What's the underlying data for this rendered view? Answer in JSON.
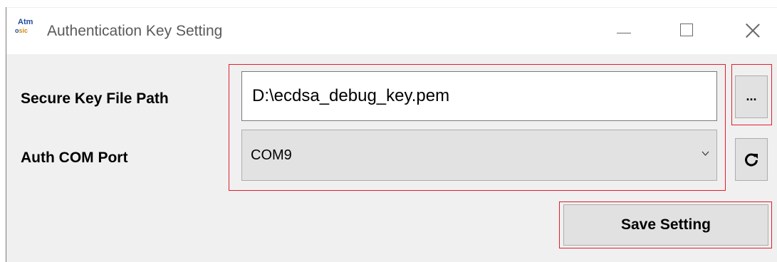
{
  "window": {
    "title": "Authentication Key Setting",
    "logo_top": "Atm",
    "logo_bottom_a": "o",
    "logo_bottom_b": "sic"
  },
  "form": {
    "key_path_label": "Secure Key File Path",
    "key_path_value": "D:\\ecdsa_debug_key.pem",
    "browse_label": "...",
    "com_port_label": "Auth COM Port",
    "com_port_value": "COM9",
    "refresh_icon": "refresh-icon",
    "save_label": "Save Setting"
  },
  "colors": {
    "highlight": "#e01f2a",
    "window_bg": "#f0f0f0",
    "button_bg": "#e1e1e1"
  }
}
